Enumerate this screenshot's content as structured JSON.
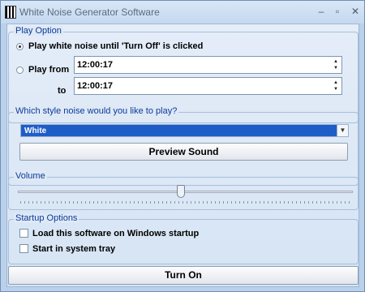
{
  "window": {
    "title": "White Noise Generator Software",
    "controls": {
      "minimize": "–",
      "restore": "▫",
      "close": "✕"
    }
  },
  "play_option": {
    "group_title": "Play Option",
    "until_off_label": "Play white noise until 'Turn Off' is clicked",
    "play_from_label": "Play from",
    "to_label": "to",
    "from_time": "12:00:17",
    "to_time": "12:00:17",
    "selected": "until_off"
  },
  "style": {
    "group_title": "Which style noise would you like to play?",
    "selected_value": "White",
    "preview_label": "Preview Sound"
  },
  "volume": {
    "group_title": "Volume",
    "level_fraction": 0.5
  },
  "startup": {
    "group_title": "Startup Options",
    "load_on_startup_label": "Load this software on Windows startup",
    "system_tray_label": "Start in system tray"
  },
  "turn_on_label": "Turn On",
  "icons": {
    "app": "white-noise-icon",
    "spin": "spin-arrows-icon",
    "dropdown": "chevron-down-icon"
  }
}
